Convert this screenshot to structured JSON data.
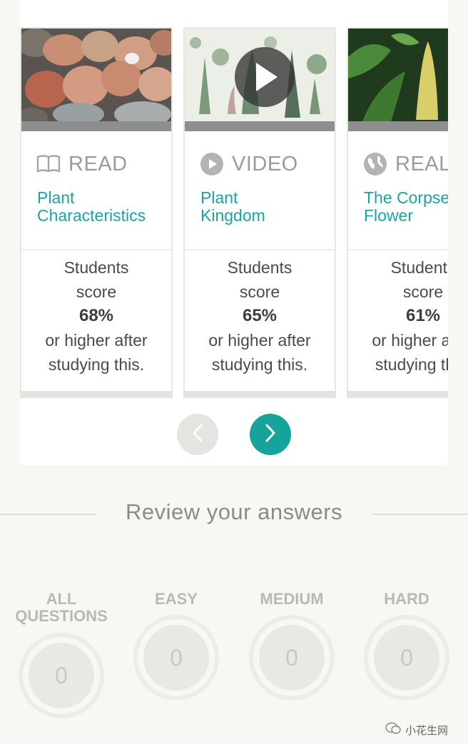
{
  "cards": [
    {
      "type": "READ",
      "icon": "book-icon",
      "title_line1": "Plant",
      "title_line2": "Characteristics",
      "score_line1": "Students",
      "score_line2": "score",
      "score_pct": "68%",
      "score_line3": "or higher after",
      "score_line4": "studying this."
    },
    {
      "type": "VIDEO",
      "icon": "play-circle-icon",
      "title_line1": "Plant",
      "title_line2": "Kingdom",
      "score_line1": "Students",
      "score_line2": "score",
      "score_pct": "65%",
      "score_line3": "or higher after",
      "score_line4": "studying this."
    },
    {
      "type": "REAL",
      "icon": "globe-icon",
      "title_line1": "The Corpse",
      "title_line2": "Flower",
      "score_line1": "Students",
      "score_line2": "score",
      "score_pct": "61%",
      "score_line3": "or higher after",
      "score_line4": "studying this."
    }
  ],
  "nav": {
    "prev_icon": "chevron-left-icon",
    "next_icon": "chevron-right-icon"
  },
  "review": {
    "title": "Review your answers",
    "filters": [
      {
        "label_line1": "ALL",
        "label_line2": "QUESTIONS",
        "count": "0"
      },
      {
        "label_line1": "EASY",
        "label_line2": "",
        "count": "0"
      },
      {
        "label_line1": "MEDIUM",
        "label_line2": "",
        "count": "0"
      },
      {
        "label_line1": "HARD",
        "label_line2": "",
        "count": "0"
      }
    ]
  },
  "watermark": {
    "text": "小花生网"
  },
  "colors": {
    "accent": "#16a39c",
    "title_teal": "#1aa5a0",
    "background": "#f7f7f4"
  }
}
